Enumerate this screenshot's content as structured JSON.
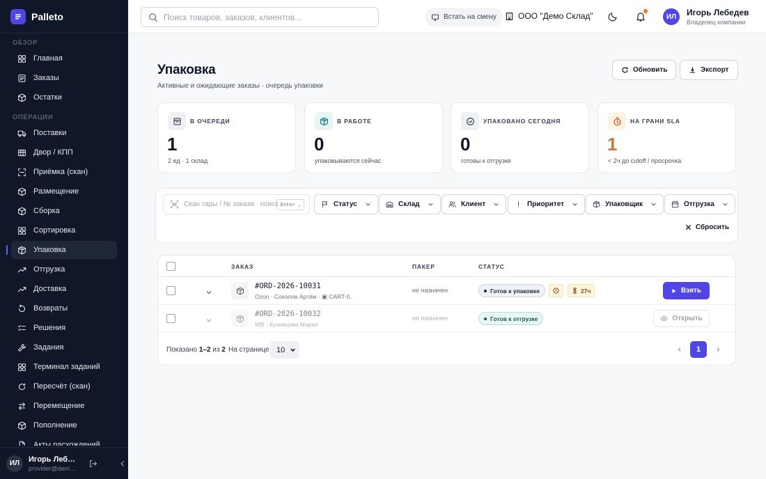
{
  "app": {
    "name": "Palleto"
  },
  "sidebar": {
    "sections": [
      {
        "title": "ОБЗОР",
        "items": [
          {
            "label": "Главная",
            "icon": "grid-icon"
          },
          {
            "label": "Заказы",
            "icon": "list-icon"
          },
          {
            "label": "Остатки",
            "icon": "box-icon"
          }
        ]
      },
      {
        "title": "ОПЕРАЦИИ",
        "items": [
          {
            "label": "Поставки",
            "icon": "truck-icon"
          },
          {
            "label": "Двор / КПП",
            "icon": "gate-icon"
          },
          {
            "label": "Приёмка (скан)",
            "icon": "scan-icon"
          },
          {
            "label": "Размещение",
            "icon": "box-icon"
          },
          {
            "label": "Сборка",
            "icon": "box-icon"
          },
          {
            "label": "Сортировка",
            "icon": "grid-icon"
          },
          {
            "label": "Упаковка",
            "icon": "package-icon",
            "active": true
          },
          {
            "label": "Отгрузка",
            "icon": "trend-icon"
          },
          {
            "label": "Доставка",
            "icon": "trend-icon"
          },
          {
            "label": "Возвраты",
            "icon": "return-icon"
          },
          {
            "label": "Решения",
            "icon": "checklist-icon"
          },
          {
            "label": "Задания",
            "icon": "wrench-icon"
          },
          {
            "label": "Терминал заданий",
            "icon": "grid-icon"
          },
          {
            "label": "Пересчёт (скан)",
            "icon": "refresh-icon"
          },
          {
            "label": "Перемещение",
            "icon": "swap-icon"
          },
          {
            "label": "Пополнение",
            "icon": "box-icon"
          },
          {
            "label": "Акты расхождений",
            "icon": "doc-icon"
          }
        ]
      }
    ],
    "footer": {
      "initials": "ИЛ",
      "name": "Игорь Лебедев",
      "email": "provider@demo.palleto.ru"
    }
  },
  "topbar": {
    "search_placeholder": "Поиск товаров, заказов, клиентов...",
    "shift_label": "Встать на смену",
    "org": "ООО \"Демо Склад\"",
    "user": {
      "initials": "ИЛ",
      "name": "Игорь Лебедев",
      "role": "Владелец компании"
    }
  },
  "page": {
    "title": "Упаковка",
    "subtitle": "Активные и ожидающие заказы · очередь упаковки",
    "refresh_label": "Обновить",
    "export_label": "Экспорт"
  },
  "stats": [
    {
      "label": "В ОЧЕРЕДИ",
      "value": "1",
      "note": "2 ед · 1 склад",
      "icon": "inbox-icon",
      "icon_bg": "#eef0f4",
      "icon_color": "#374151",
      "value_color": "#111827"
    },
    {
      "label": "В РАБОТЕ",
      "value": "0",
      "note": "упаковываются сейчас",
      "icon": "package-icon",
      "icon_bg": "#e7f6f4",
      "icon_color": "#0f766e",
      "value_color": "#111827"
    },
    {
      "label": "УПАКОВАНО СЕГОДНЯ",
      "value": "0",
      "note": "готовы к отгрузке",
      "icon": "check-circle-icon",
      "icon_bg": "#eef0f4",
      "icon_color": "#374151",
      "value_color": "#111827"
    },
    {
      "label": "НА ГРАНИ SLA",
      "value": "1",
      "note": "< 2ч до cutoff / просрочка",
      "icon": "timer-icon",
      "icon_bg": "#fdf3e3",
      "icon_color": "#c2410c",
      "value_color": "#c27a3e"
    }
  ],
  "filters": {
    "scan_placeholder": "Скан тары / № заказа · поиск",
    "enter_hint": "Enter ⌄",
    "buttons": [
      {
        "label": "Статус",
        "icon": "flag-icon"
      },
      {
        "label": "Склад",
        "icon": "warehouse-icon"
      },
      {
        "label": "Клиент",
        "icon": "users-icon"
      },
      {
        "label": "Приоритет",
        "icon": "exclamation-icon"
      },
      {
        "label": "Упаковщик",
        "icon": "package-icon"
      },
      {
        "label": "Отгрузка",
        "icon": "calendar-icon"
      }
    ],
    "reset_label": "Сбросить"
  },
  "table": {
    "columns": [
      "ЗАКАЗ",
      "ПАКЕР",
      "СТАТУС"
    ],
    "rows": [
      {
        "order": "#ORD-2026-10031",
        "meta": "Ozon · Соколов Артём · ▣ CART-0…",
        "packer": "не назначен",
        "status": "Готов к упаковке",
        "sla": "27ч",
        "action": "Взять",
        "dim": false
      },
      {
        "order": "#ORD-2026-10032",
        "meta": "WB · Кузнецова Мария",
        "packer": "не назначен",
        "status": "Готов к отгрузке",
        "action": "Открыть",
        "dim": true
      }
    ],
    "footer": {
      "shown_prefix": "Показано",
      "shown_range": "1–2",
      "shown_of": "из",
      "shown_total": "2",
      "per_page_label": "На странице",
      "per_page": "10",
      "current_page": "1"
    }
  }
}
